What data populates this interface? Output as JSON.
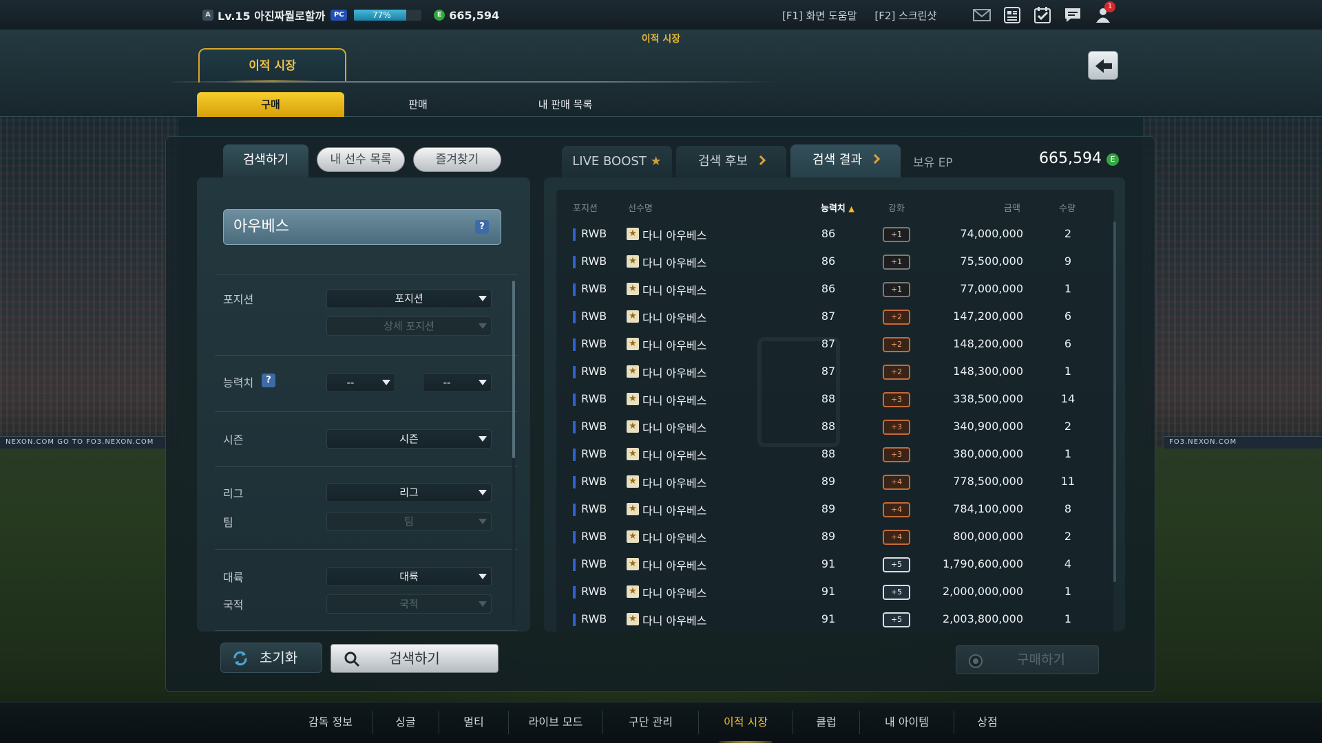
{
  "topbar": {
    "level_badge": "A",
    "level_text": "Lv.15 아진짜뭘로할까",
    "pc_badge": "PC",
    "xp_percent": 77,
    "xp_text": "77%",
    "ep_coin": "E",
    "ep_amount": "665,594",
    "f1_help": "[F1] 화면 도움말",
    "f2_screenshot": "[F2] 스크린샷",
    "notification_count": "1",
    "icons": [
      "mail-icon",
      "card-list-icon",
      "calendar-check-icon",
      "chat-icon",
      "user-alert-icon"
    ]
  },
  "header": {
    "page_title": "이적 시장",
    "main_tab": "이적 시장",
    "sub_tabs": [
      "구매",
      "판매",
      "내 판매 목록"
    ],
    "active_sub_tab": 0
  },
  "left": {
    "tabs": [
      "검색하기",
      "내 선수 목록",
      "즐겨찾기"
    ],
    "search_value": "아우베스",
    "help": "?",
    "filters": {
      "position_label": "포지션",
      "position_value": "포지션",
      "position_detail": "상세 포지션",
      "ability_label": "능력치",
      "ability_help": "?",
      "ability_min": "--",
      "ability_max": "--",
      "season_label": "시즌",
      "season_value": "시즌",
      "league_label": "리그",
      "league_value": "리그",
      "team_label": "팀",
      "team_value": "팀",
      "continent_label": "대륙",
      "continent_value": "대륙",
      "nation_label": "국적",
      "nation_value": "국적"
    },
    "reset_button": "초기화",
    "search_button": "검색하기"
  },
  "right": {
    "tabs": [
      "LIVE BOOST",
      "검색 후보",
      "검색 결과"
    ],
    "ep_label": "보유 EP",
    "ep_value": "665,594",
    "ep_coin": "E",
    "columns": [
      "포지션",
      "선수명",
      "능력치",
      "강화",
      "금액",
      "수량"
    ],
    "rows": [
      {
        "pos": "RWB",
        "name": "다니 아우베스",
        "ovr": "86",
        "enh": "+1",
        "price": "74,000,000",
        "qty": "2"
      },
      {
        "pos": "RWB",
        "name": "다니 아우베스",
        "ovr": "86",
        "enh": "+1",
        "price": "75,500,000",
        "qty": "9"
      },
      {
        "pos": "RWB",
        "name": "다니 아우베스",
        "ovr": "86",
        "enh": "+1",
        "price": "77,000,000",
        "qty": "1"
      },
      {
        "pos": "RWB",
        "name": "다니 아우베스",
        "ovr": "87",
        "enh": "+2",
        "price": "147,200,000",
        "qty": "6"
      },
      {
        "pos": "RWB",
        "name": "다니 아우베스",
        "ovr": "87",
        "enh": "+2",
        "price": "148,200,000",
        "qty": "6"
      },
      {
        "pos": "RWB",
        "name": "다니 아우베스",
        "ovr": "87",
        "enh": "+2",
        "price": "148,300,000",
        "qty": "1"
      },
      {
        "pos": "RWB",
        "name": "다니 아우베스",
        "ovr": "88",
        "enh": "+3",
        "price": "338,500,000",
        "qty": "14"
      },
      {
        "pos": "RWB",
        "name": "다니 아우베스",
        "ovr": "88",
        "enh": "+3",
        "price": "340,900,000",
        "qty": "2"
      },
      {
        "pos": "RWB",
        "name": "다니 아우베스",
        "ovr": "88",
        "enh": "+3",
        "price": "380,000,000",
        "qty": "1"
      },
      {
        "pos": "RWB",
        "name": "다니 아우베스",
        "ovr": "89",
        "enh": "+4",
        "price": "778,500,000",
        "qty": "11"
      },
      {
        "pos": "RWB",
        "name": "다니 아우베스",
        "ovr": "89",
        "enh": "+4",
        "price": "784,100,000",
        "qty": "8"
      },
      {
        "pos": "RWB",
        "name": "다니 아우베스",
        "ovr": "89",
        "enh": "+4",
        "price": "800,000,000",
        "qty": "2"
      },
      {
        "pos": "RWB",
        "name": "다니 아우베스",
        "ovr": "91",
        "enh": "+5",
        "price": "1,790,600,000",
        "qty": "4"
      },
      {
        "pos": "RWB",
        "name": "다니 아우베스",
        "ovr": "91",
        "enh": "+5",
        "price": "2,000,000,000",
        "qty": "1"
      },
      {
        "pos": "RWB",
        "name": "다니 아우베스",
        "ovr": "91",
        "enh": "+5",
        "price": "2,003,800,000",
        "qty": "1"
      }
    ],
    "buy_button": "구매하기"
  },
  "bottom_nav": {
    "items": [
      "감독 정보",
      "싱글",
      "멀티",
      "라이브 모드",
      "구단 관리",
      "이적 시장",
      "클럽",
      "내 아이템",
      "상점"
    ],
    "active_index": 5
  },
  "background": {
    "adboard_left": "NEXON.COM   GO TO FO3.NEXON.COM",
    "adboard_right": "FO3.NEXON.COM"
  },
  "colors": {
    "accent_gold": "#f3c142",
    "ep_green": "#31a83e",
    "position_blue": "#2a62d6"
  }
}
